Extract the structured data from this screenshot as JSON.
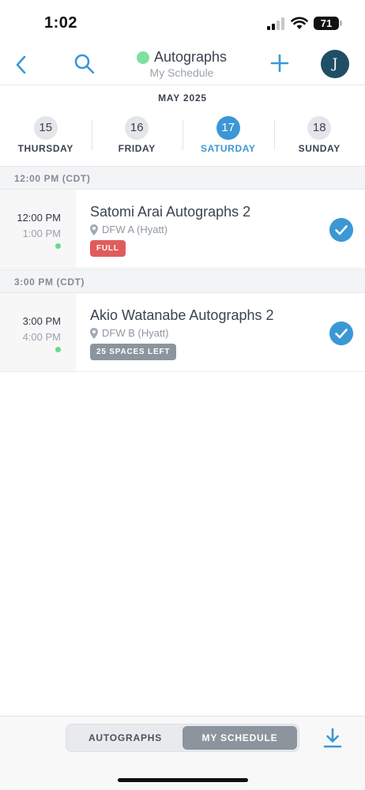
{
  "status_bar": {
    "time": "1:02",
    "battery": "71"
  },
  "header": {
    "title": "Autographs",
    "subtitle": "My Schedule",
    "avatar_initial": "J"
  },
  "date_strip": {
    "month": "MAY 2025",
    "days": [
      {
        "num": "15",
        "name": "THURSDAY",
        "selected": false
      },
      {
        "num": "16",
        "name": "FRIDAY",
        "selected": false
      },
      {
        "num": "17",
        "name": "SATURDAY",
        "selected": true
      },
      {
        "num": "18",
        "name": "SUNDAY",
        "selected": false
      }
    ]
  },
  "schedule": [
    {
      "slot": "12:00 PM (CDT)",
      "start": "12:00 PM",
      "end": "1:00 PM",
      "title": "Satomi Arai Autographs 2",
      "location": "DFW A (Hyatt)",
      "badge": "FULL",
      "badge_color": "#e05c5c",
      "checked": true
    },
    {
      "slot": "3:00 PM (CDT)",
      "start": "3:00 PM",
      "end": "4:00 PM",
      "title": "Akio Watanabe Autographs 2",
      "location": "DFW B (Hyatt)",
      "badge": "25 SPACES LEFT",
      "badge_color": "#8c959e",
      "checked": true
    }
  ],
  "bottom_bar": {
    "tabs": [
      "AUTOGRAPHS",
      "MY SCHEDULE"
    ],
    "active_tab": "MY SCHEDULE"
  },
  "colors": {
    "accent": "#3b98d5",
    "live_dot": "#7ee0a1",
    "avatar_bg": "#1f4e66"
  },
  "icons": [
    "chevron-left-icon",
    "search-icon",
    "plus-icon",
    "location-pin-icon",
    "checkmark-icon",
    "download-icon"
  ]
}
